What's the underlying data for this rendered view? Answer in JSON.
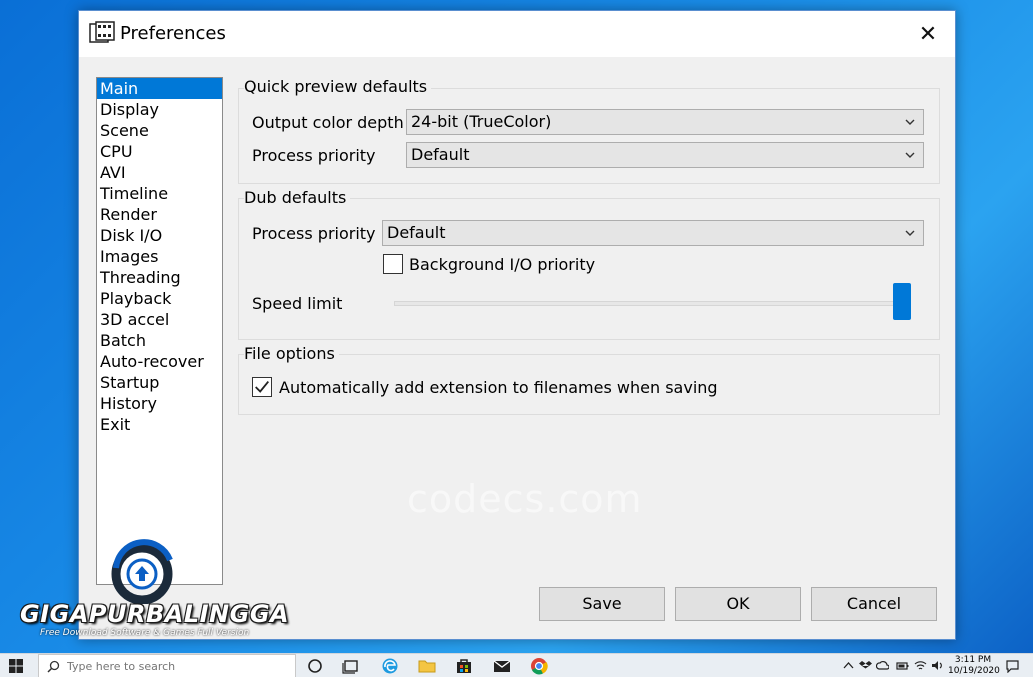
{
  "window": {
    "title": "Preferences",
    "close_glyph": "✕"
  },
  "nav": {
    "items": [
      "Main",
      "Display",
      "Scene",
      "CPU",
      "AVI",
      "Timeline",
      "Render",
      "Disk I/O",
      "Images",
      "Threading",
      "Playback",
      "3D accel",
      "Batch",
      "Auto-recover",
      "Startup",
      "History",
      "Exit"
    ],
    "selected": "Main"
  },
  "quick_preview": {
    "title": "Quick preview defaults",
    "output_color_depth_label": "Output color depth",
    "output_color_depth_value": "24-bit (TrueColor)",
    "process_priority_label": "Process priority",
    "process_priority_value": "Default"
  },
  "dub": {
    "title": "Dub defaults",
    "process_priority_label": "Process priority",
    "process_priority_value": "Default",
    "background_io_label": "Background I/O priority",
    "background_io_checked": false,
    "speed_limit_label": "Speed limit",
    "speed_limit_fraction": 1.0
  },
  "file_options": {
    "title": "File options",
    "auto_ext_label": "Automatically add extension to filenames when saving",
    "auto_ext_checked": true
  },
  "buttons": {
    "save": "Save",
    "ok": "OK",
    "cancel": "Cancel"
  },
  "watermark": "codecs.com",
  "brand": {
    "name": "GIGAPURBALINGGA",
    "tagline": "Free Download Software & Games Full Version"
  },
  "taskbar": {
    "search_placeholder": "Type here to search",
    "time": "3:11 PM",
    "date": "10/19/2020"
  },
  "colors": {
    "accent": "#0078d7",
    "dialog_bg": "#f0f0f0",
    "desktop": "#1a8de8"
  },
  "icons": [
    "app-icon",
    "close-icon",
    "chevron-down-icon",
    "checkmark-icon",
    "windows-start-icon",
    "search-icon",
    "task-view-icon",
    "edge-icon",
    "file-explorer-icon",
    "store-icon",
    "mail-icon",
    "chrome-icon",
    "wifi-icon",
    "volume-icon",
    "battery-icon",
    "notification-icon"
  ]
}
